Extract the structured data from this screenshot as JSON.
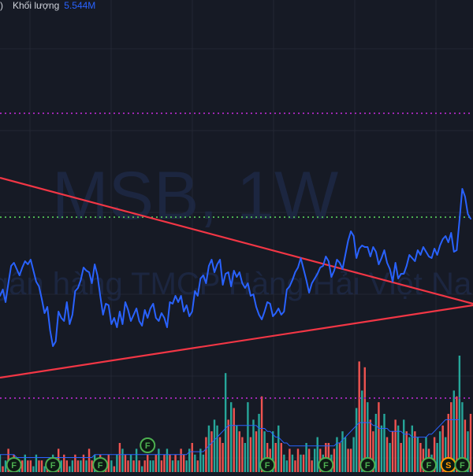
{
  "legend": {
    "paren": ")",
    "volume_label": "Khối lượng",
    "volume_value": "5.544M"
  },
  "watermark": {
    "title": "MSB, 1W",
    "subtitle": "Ngân hàng TMCP Hàng Hải Việt Nam"
  },
  "colors": {
    "background": "#161a25",
    "grid": "#232734",
    "price_line": "#2962ff",
    "trendline": "#f23645",
    "level_purple": "#9c27b0",
    "level_green": "#4caf50",
    "vol_up": "#26a69a",
    "vol_down": "#ef5350",
    "vol_ma": "#2962ff"
  },
  "chart_data": {
    "type": "line",
    "series": [
      {
        "values": [
          32,
          36,
          28,
          40,
          51,
          53,
          49,
          45,
          50,
          54,
          52,
          55,
          48,
          41,
          38,
          30,
          21,
          25,
          10,
          0,
          3,
          22,
          18,
          16,
          28,
          14,
          20,
          35,
          37,
          42,
          50,
          48,
          47,
          40,
          52,
          45,
          32,
          20,
          27,
          26,
          14,
          18,
          12,
          22,
          14,
          28,
          23,
          16,
          20,
          24,
          16,
          13,
          23,
          18,
          24,
          27,
          18,
          16,
          21,
          18,
          12,
          28,
          27,
          32,
          28,
          32,
          22,
          26,
          19,
          22,
          35,
          32,
          43,
          45,
          40,
          51,
          55,
          47,
          52,
          55,
          39,
          46,
          47,
          38,
          48,
          44,
          47,
          40,
          37,
          40,
          32,
          33,
          25,
          20,
          17,
          22,
          28,
          27,
          19,
          21,
          24,
          20,
          22,
          36,
          38,
          42,
          47,
          50,
          56,
          49,
          42,
          34,
          40,
          43,
          46,
          50,
          51,
          57,
          54,
          44,
          48,
          55,
          53,
          49,
          58,
          67,
          73,
          70,
          56,
          62,
          64,
          63,
          63,
          57,
          63,
          60,
          52,
          56,
          61,
          53,
          49,
          41,
          53,
          43,
          46,
          46,
          51,
          58,
          56,
          54,
          61,
          58,
          63,
          60,
          57,
          56,
          62,
          58,
          64,
          68,
          70,
          66,
          72,
          60,
          61,
          80,
          100,
          95,
          84,
          81
        ]
      }
    ],
    "volume": {
      "values": [
        3,
        1,
        2,
        4,
        2,
        3,
        2,
        1,
        2,
        3,
        2,
        2,
        1,
        3,
        2,
        2,
        1,
        2,
        1,
        3,
        2,
        4,
        2,
        3,
        2,
        1,
        2,
        3,
        2,
        2,
        3,
        2,
        4,
        2,
        3,
        2,
        3,
        2,
        2,
        3,
        2,
        1,
        3,
        5,
        4,
        3,
        2,
        3,
        2,
        4,
        2,
        1,
        2,
        3,
        2,
        2,
        3,
        4,
        2,
        3,
        4,
        3,
        2,
        3,
        2,
        4,
        3,
        2,
        4,
        5,
        3,
        2,
        4,
        3,
        6,
        8,
        7,
        9,
        8,
        6,
        5,
        17,
        9,
        12,
        11,
        8,
        7,
        6,
        5,
        12,
        6,
        9,
        7,
        10,
        13,
        7,
        5,
        4,
        7,
        5,
        8,
        5,
        3,
        2,
        4,
        3,
        2,
        4,
        3,
        3,
        5,
        4,
        2,
        4,
        6,
        4,
        3,
        5,
        5,
        3,
        4,
        6,
        5,
        7,
        6,
        4,
        4,
        6,
        11,
        19,
        14,
        18,
        12,
        9,
        7,
        10,
        12,
        8,
        10,
        6,
        5,
        7,
        9,
        8,
        5,
        9,
        7,
        6,
        8,
        7,
        6,
        5,
        4,
        6,
        4,
        3,
        6,
        5,
        7,
        8,
        6,
        10,
        12,
        14,
        13,
        20,
        12,
        9,
        7,
        10
      ],
      "directions": [
        1,
        0,
        1,
        0,
        1,
        0,
        0,
        1,
        0,
        1,
        0,
        0,
        1,
        1,
        0,
        0,
        1,
        0,
        1,
        1,
        0,
        0,
        1,
        0,
        0,
        1,
        1,
        0,
        0,
        1,
        0,
        1,
        0,
        0,
        1,
        1,
        0,
        1,
        0,
        0,
        1,
        0,
        1,
        0,
        1,
        0,
        0,
        1,
        0,
        1,
        0,
        1,
        0,
        0,
        1,
        1,
        0,
        1,
        0,
        0,
        1,
        0,
        1,
        0,
        1,
        0,
        0,
        1,
        1,
        0,
        1,
        0,
        1,
        1,
        0,
        1,
        0,
        1,
        1,
        0,
        0,
        1,
        0,
        1,
        0,
        1,
        0,
        0,
        1,
        1,
        0,
        1,
        0,
        1,
        0,
        1,
        0,
        0,
        1,
        0,
        1,
        0,
        1,
        1,
        0,
        1,
        0,
        0,
        1,
        0,
        1,
        0,
        0,
        1,
        1,
        0,
        1,
        0,
        0,
        1,
        0,
        1,
        0,
        1,
        1,
        0,
        0,
        1,
        1,
        0,
        1,
        0,
        1,
        0,
        0,
        1,
        0,
        1,
        1,
        0,
        1,
        0,
        0,
        1,
        0,
        1,
        0,
        1,
        1,
        0,
        1,
        0,
        0,
        1,
        0,
        1,
        0,
        1,
        1,
        0,
        1,
        0,
        0,
        1,
        0,
        1,
        1,
        0,
        1,
        0
      ]
    },
    "volume_ma": [
      3,
      3,
      3,
      3,
      3,
      3,
      2.5,
      2.5,
      2.5,
      2.5,
      2.5,
      2.5,
      2.5,
      2.5,
      2.5,
      2.5,
      2.5,
      2.5,
      2.5,
      2.5,
      2.5,
      2.5,
      2.5,
      2.5,
      2.5,
      2.5,
      2.5,
      2.5,
      2.5,
      2.5,
      2.5,
      2.5,
      2.5,
      2.5,
      3,
      3,
      3,
      3,
      3,
      3,
      3,
      3,
      3,
      3,
      3,
      3,
      3,
      3,
      3,
      3,
      3,
      3,
      3,
      3,
      3,
      3,
      3,
      3,
      3,
      3,
      3,
      3,
      3,
      3,
      3,
      3,
      3,
      3,
      3.5,
      3.5,
      3.5,
      3.5,
      3.5,
      3.5,
      4,
      4.5,
      5,
      5.5,
      6,
      6.5,
      7,
      7.5,
      8,
      8,
      8,
      8,
      8,
      8,
      8,
      8,
      8,
      8,
      8,
      7.5,
      7.5,
      7.5,
      7,
      7,
      6.5,
      6,
      6,
      5.5,
      5,
      5,
      4.5,
      4.5,
      4.5,
      4.5,
      4.5,
      4.5,
      4.5,
      4.5,
      4.5,
      4.5,
      4.5,
      4.5,
      4.5,
      4.5,
      4.5,
      4.5,
      4.5,
      5,
      5,
      5.5,
      6,
      6.5,
      7,
      7.5,
      8,
      8.5,
      8.5,
      8.5,
      8.5,
      8.5,
      8,
      8,
      7.5,
      7.5,
      7.5,
      7.5,
      7,
      7,
      7,
      7,
      7,
      6.5,
      6.5,
      6.5,
      6,
      6,
      6,
      6,
      6,
      6,
      6.5,
      6.5,
      7,
      7.5,
      8,
      8.5,
      9,
      9,
      9,
      9,
      9,
      9
    ],
    "events": [
      {
        "letter": "F",
        "slot": "bottom",
        "index": 5
      },
      {
        "letter": "F",
        "slot": "bottom",
        "index": 19
      },
      {
        "letter": "F",
        "slot": "bottom",
        "index": 36
      },
      {
        "letter": "F",
        "slot": "upper",
        "index": 53
      },
      {
        "letter": "F",
        "slot": "bottom",
        "index": 96
      },
      {
        "letter": "F",
        "slot": "bottom",
        "index": 117
      },
      {
        "letter": "F",
        "slot": "bottom",
        "index": 132
      },
      {
        "letter": "F",
        "slot": "bottom",
        "index": 154
      },
      {
        "letter": "S",
        "slot": "bottom",
        "index": 161
      },
      {
        "letter": "F",
        "slot": "bottom",
        "index": 166
      }
    ],
    "trendlines": [
      {
        "name": "upper",
        "from": 107,
        "to": 27
      },
      {
        "name": "lower",
        "from": -20,
        "to": 26
      }
    ],
    "levels": [
      {
        "name": "purple-top",
        "value": 148
      },
      {
        "name": "green-dotted",
        "value": 82
      },
      {
        "name": "purple-bottom",
        "value": -33
      }
    ],
    "ylim": [
      -80,
      220
    ],
    "grid": true
  }
}
